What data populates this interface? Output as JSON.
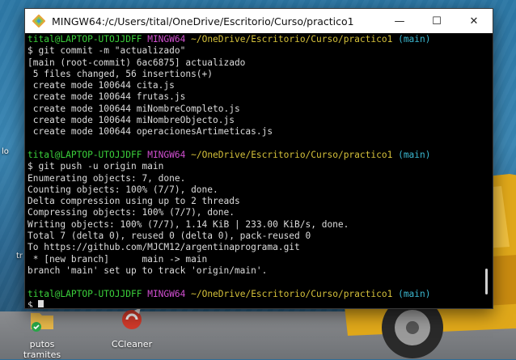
{
  "window": {
    "title": "MINGW64:/c/Users/tital/OneDrive/Escritorio/Curso/practico1",
    "minimize_symbol": "—",
    "maximize_symbol": "☐",
    "close_symbol": "✕",
    "icon": "git-bash-icon"
  },
  "terminal": {
    "prompt1": {
      "user": "tital@LAPTOP-UTOJJDFF",
      "shell": "MINGW64",
      "path": "~/OneDrive/Escritorio/Curso/practico1",
      "branch": "(main)"
    },
    "cmd1": "$ git commit -m \"actualizado\"",
    "out1": [
      "[main (root-commit) 6ac6875] actualizado",
      " 5 files changed, 56 insertions(+)",
      " create mode 100644 cita.js",
      " create mode 100644 frutas.js",
      " create mode 100644 miNombreCompleto.js",
      " create mode 100644 miNombreObjecto.js",
      " create mode 100644 operacionesArtimeticas.js"
    ],
    "prompt2": {
      "user": "tital@LAPTOP-UTOJJDFF",
      "shell": "MINGW64",
      "path": "~/OneDrive/Escritorio/Curso/practico1",
      "branch": "(main)"
    },
    "cmd2": "$ git push -u origin main",
    "out2": [
      "Enumerating objects: 7, done.",
      "Counting objects: 100% (7/7), done.",
      "Delta compression using up to 2 threads",
      "Compressing objects: 100% (7/7), done.",
      "Writing objects: 100% (7/7), 1.14 KiB | 233.00 KiB/s, done.",
      "Total 7 (delta 0), reused 0 (delta 0), pack-reused 0",
      "To https://github.com/MJCM12/argentinaprograma.git",
      " * [new branch]      main -> main",
      "branch 'main' set up to track 'origin/main'."
    ],
    "prompt3": {
      "user": "tital@LAPTOP-UTOJJDFF",
      "shell": "MINGW64",
      "path": "~/OneDrive/Escritorio/Curso/practico1",
      "branch": "(main)"
    },
    "cmd3": "$ "
  },
  "desktop": {
    "icons": [
      {
        "label": "putos tramites",
        "icon": "folder-icon"
      },
      {
        "label": "CCleaner",
        "icon": "ccleaner-icon"
      }
    ],
    "edge_labels": [
      "lo",
      "tr"
    ]
  },
  "colors": {
    "prompt_user": "#3bd13b",
    "prompt_shell": "#d14fd1",
    "prompt_path": "#d4c03a",
    "prompt_branch": "#3bb8d1",
    "terminal_bg": "#000000",
    "terminal_fg": "#dcdcdc"
  }
}
